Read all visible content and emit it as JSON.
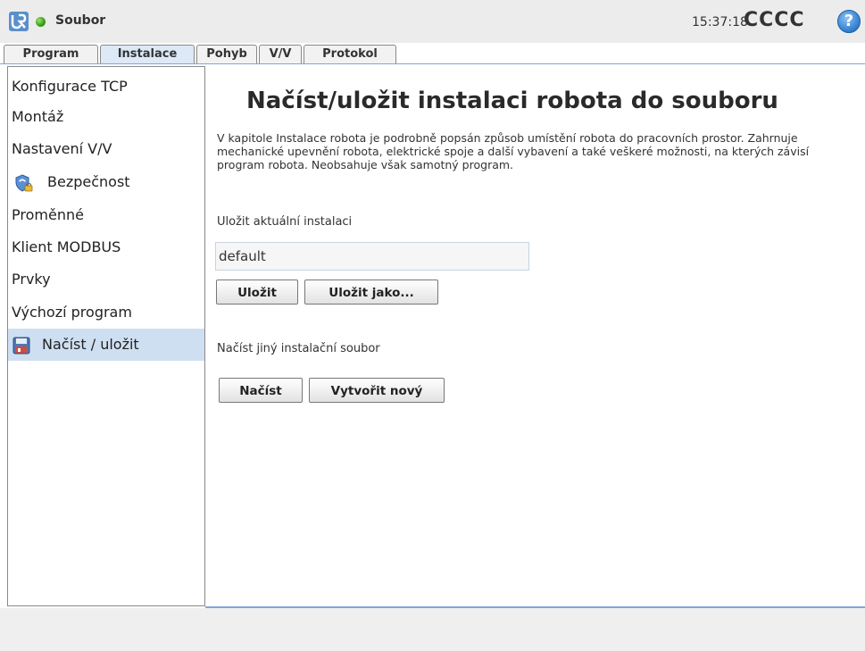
{
  "topbar": {
    "file_menu": "Soubor",
    "clock": "15:37:18",
    "robot_name": "CCCC",
    "help_symbol": "?"
  },
  "tabs": [
    {
      "label": "Program"
    },
    {
      "label": "Instalace",
      "active": true
    },
    {
      "label": "Pohyb"
    },
    {
      "label": "V/V"
    },
    {
      "label": "Protokol"
    }
  ],
  "sidebar": {
    "items": [
      {
        "label": "Konfigurace TCP"
      },
      {
        "label": "Montáž"
      },
      {
        "label": "Nastavení V/V"
      },
      {
        "label": "Bezpečnost",
        "icon": "shield-lock-icon"
      },
      {
        "label": "Proměnné"
      },
      {
        "label": "Klient MODBUS"
      },
      {
        "label": "Prvky"
      },
      {
        "label": "Výchozí program"
      },
      {
        "label": "Načíst / uložit",
        "icon": "floppy-disk-icon",
        "active": true
      }
    ]
  },
  "main": {
    "title": "Načíst/uložit instalaci robota do souboru",
    "description": "V kapitole Instalace robota je podrobně popsán způsob umístění robota do pracovních prostor. Zahrnuje mechanické upevnění robota, elektrické spoje a další vybavení a také veškeré možnosti, na kterých závisí program robota. Neobsahuje však samotný program.",
    "save_section_label": "Uložit aktuální instalaci",
    "installation_name_value": "default",
    "save_button": "Uložit",
    "save_as_button": "Uložit jako...",
    "load_section_label": "Načíst jiný instalační soubor",
    "load_button": "Načíst",
    "create_new_button": "Vytvořit nový"
  },
  "colors": {
    "accent_blue": "#7ea7d8",
    "active_item_bg": "#cfdff2",
    "status_green": "#3fa11b"
  }
}
